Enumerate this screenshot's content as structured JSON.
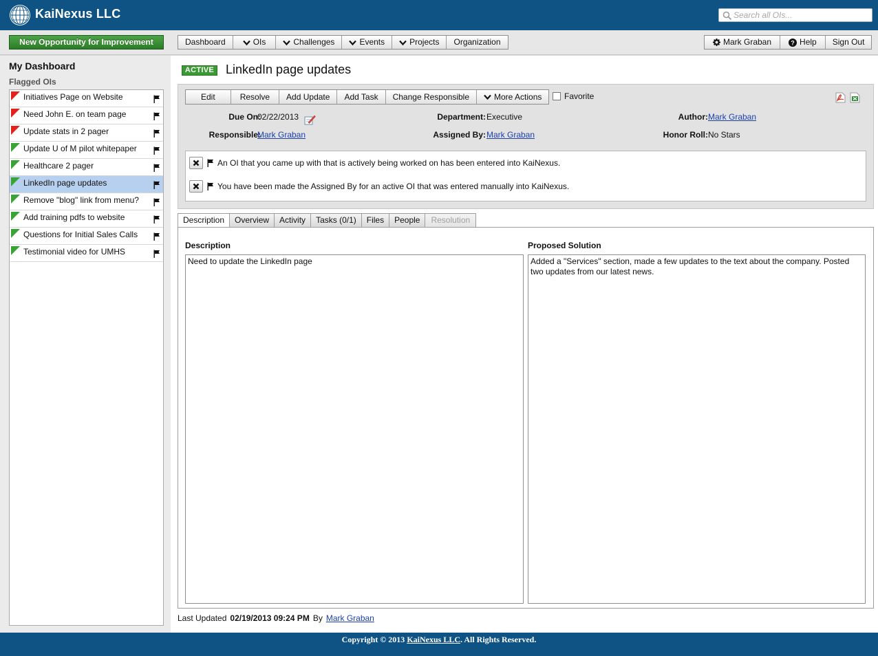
{
  "app": {
    "brand": "KaiNexus LLC"
  },
  "search": {
    "placeholder": "Search all OIs..."
  },
  "nav": {
    "new_oi": "New Opportunity for Improvement",
    "items": [
      "Dashboard",
      "OIs",
      "Challenges",
      "Events",
      "Projects",
      "Organization"
    ],
    "user": "Mark Graban",
    "help": "Help",
    "signout": "Sign Out"
  },
  "sidebar": {
    "title": "My Dashboard",
    "subtitle": "Flagged OIs",
    "items": [
      {
        "label": "Initiatives Page on Website",
        "status": "red"
      },
      {
        "label": "Need John E. on team page",
        "status": "red"
      },
      {
        "label": "Update stats in 2 pager",
        "status": "red"
      },
      {
        "label": "Update U of M pilot whitepaper",
        "status": "green"
      },
      {
        "label": "Healthcare 2 pager",
        "status": "green"
      },
      {
        "label": "LinkedIn page updates",
        "status": "green",
        "selected": true
      },
      {
        "label": "Remove \"blog\" link from menu?",
        "status": "green"
      },
      {
        "label": "Add training pdfs to website",
        "status": "green"
      },
      {
        "label": "Questions for Initial Sales Calls",
        "status": "green"
      },
      {
        "label": "Testimonial video for UMHS",
        "status": "green"
      }
    ]
  },
  "oi": {
    "status": "ACTIVE",
    "title": "LinkedIn page updates",
    "actions": [
      "Edit",
      "Resolve",
      "Add Update",
      "Add Task",
      "Change Responsible",
      "More Actions"
    ],
    "favorite": "Favorite",
    "fields": {
      "due_on_label": "Due On:",
      "due_on": "02/22/2013",
      "responsible_label": "Responsible:",
      "responsible": "Mark Graban",
      "department_label": "Department:",
      "department": "Executive",
      "assigned_by_label": "Assigned By:",
      "assigned_by": "Mark Graban",
      "author_label": "Author:",
      "author": "Mark Graban",
      "honor_roll_label": "Honor Roll:",
      "honor_roll": "No Stars"
    },
    "notifications": [
      "An OI that you came up with that is actively being worked on has been entered into KaiNexus.",
      "You have been made the Assigned By for an active OI that was entered manually into KaiNexus."
    ],
    "tabs": [
      "Description",
      "Overview",
      "Activity",
      "Tasks (0/1)",
      "Files",
      "People",
      "Resolution"
    ],
    "description_title": "Description",
    "description": "Need to update the LinkedIn page",
    "solution_title": "Proposed Solution",
    "solution": "Added a \"Services\" section, made a few updates to the text about the company. Posted two updates from our latest news.",
    "last_updated_label": "Last Updated",
    "last_updated": "02/19/2013 09:24 PM",
    "by_label": "By",
    "updated_by": "Mark Graban"
  },
  "footer": {
    "copyright_pre": "Copyright © 2013",
    "company": "KaiNexus LLC",
    "copyright_post": ". All Rights Reserved."
  },
  "colors": {
    "header": "#0f5384",
    "accent_green": "#3c9a35",
    "link": "#1b3fae",
    "selected": "#b7d0ef"
  }
}
